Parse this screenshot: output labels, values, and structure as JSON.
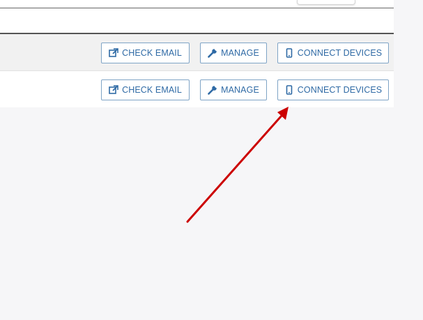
{
  "rows": [
    {
      "check_email_label": "CHECK EMAIL",
      "manage_label": "MANAGE",
      "connect_devices_label": "CONNECT DEVICES"
    },
    {
      "check_email_label": "CHECK EMAIL",
      "manage_label": "MANAGE",
      "connect_devices_label": "CONNECT DEVICES"
    }
  ],
  "icons": {
    "check_email": "external-link-icon",
    "manage": "wrench-icon",
    "connect_devices": "mobile-phone-icon"
  },
  "colors": {
    "button_text": "#2f6aa5",
    "button_border": "#7fa4c6",
    "annotation_arrow": "#cc0000"
  }
}
